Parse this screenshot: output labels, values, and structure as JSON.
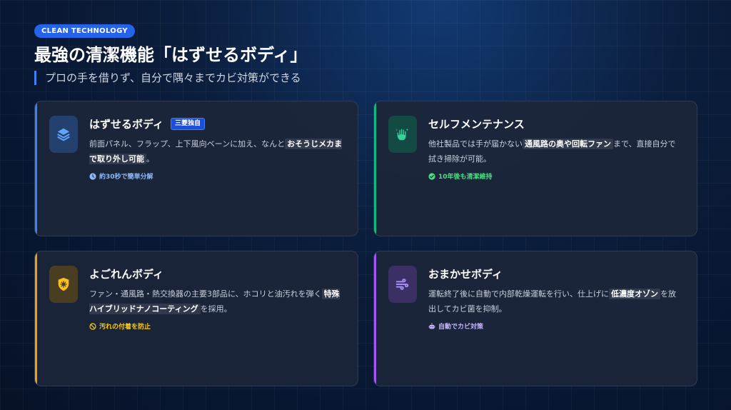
{
  "header": {
    "badge": "CLEAN TECHNOLOGY",
    "title": "最強の清潔機能「はずせるボディ」",
    "subtitle": "プロの手を借りず、自分で隅々までカビ対策ができる"
  },
  "cards": [
    {
      "title": "はずせるボディ",
      "tag": "三菱独自",
      "desc_before": "前面パネル、フラップ、上下風向ベーンに加え、なんと",
      "desc_highlight": "おそうじメカまで取り外し可能",
      "desc_after": "。",
      "note": "約30秒で簡単分解",
      "icon": "layers-icon",
      "accent": "#3b82f6",
      "icon_bg": "#23406f",
      "note_color": "#8fb7f5"
    },
    {
      "title": "セルフメンテナンス",
      "desc_before": "他社製品では手が届かない",
      "desc_highlight": "通風路の奥や回転ファン",
      "desc_after": "まで、直接自分で拭き掃除が可能。",
      "note": "10年後も清潔維持",
      "icon": "hand-sparkle-icon",
      "accent": "#10b981",
      "icon_bg": "#134a44",
      "note_color": "#4ade80"
    },
    {
      "title": "よごれんボディ",
      "desc_before": "ファン・通風路・熱交換器の主要3部品に、ホコリと油汚れを弾く",
      "desc_highlight": "特殊ハイブリッドナノコーティング",
      "desc_after": "を採用。",
      "note": "汚れの付着を防止",
      "icon": "shield-virus-icon",
      "accent": "#f59e0b",
      "icon_bg": "#4a3e22",
      "note_color": "#facc15"
    },
    {
      "title": "おまかせボディ",
      "desc_before": "運転終了後に自動で内部乾燥運転を行い、仕上げに",
      "desc_highlight": "低濃度オゾン",
      "desc_after": "を放出してカビ菌を抑制。",
      "note": "自動でカビ対策",
      "icon": "wind-icon",
      "accent": "#a855f7",
      "icon_bg": "#3b2f63",
      "note_color": "#c4b5fd"
    }
  ]
}
